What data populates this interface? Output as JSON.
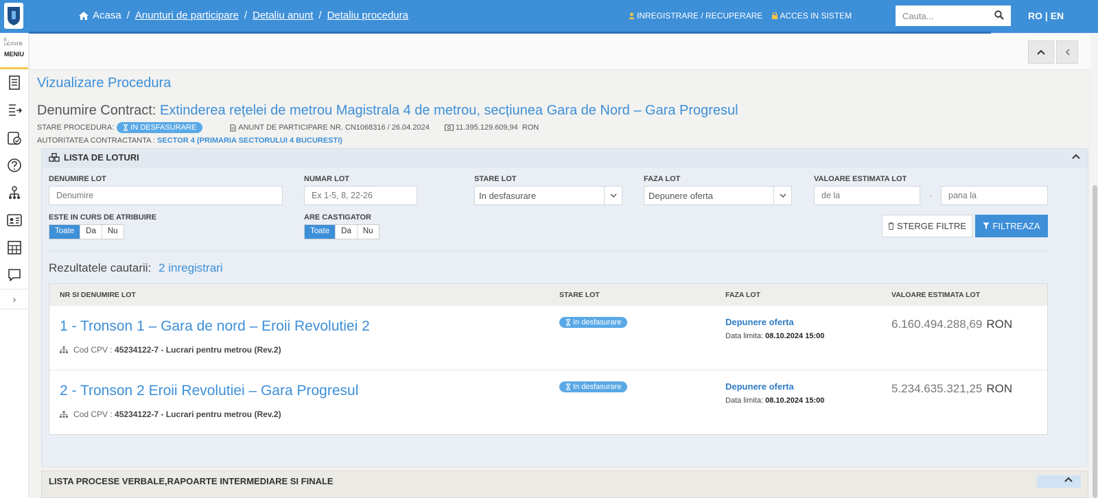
{
  "topbar": {
    "breadcrumb": {
      "home": "Acasa",
      "items": [
        "Anunturi de participare",
        "Detaliu anunt",
        "Detaliu procedura"
      ]
    },
    "register_label": "INREGISTRARE / RECUPERARE",
    "access_label": "ACCES IN SISTEM",
    "search": {
      "placeholder": "Cauta...",
      "value": ""
    },
    "lang": "RO | EN",
    "bar_color": "#3d8fd8"
  },
  "sidebar": {
    "brand": "E - LICITATIE",
    "menu_label": "MENIU",
    "icons": [
      "document-list-icon",
      "export-icon",
      "clipboard-check-icon",
      "help-icon",
      "user-tree-icon",
      "id-card-icon",
      "calendar-grid-icon",
      "chat-icon"
    ]
  },
  "header": {
    "page_title": "Vizualizare Procedura",
    "contract_label": "Denumire Contract:",
    "contract_name": "Extinderea rețelei de metrou Magistrala 4 de metrou, secțiunea Gara de Nord – Gara Progresul",
    "status_label": "STARE PROCEDURA:",
    "status_value": "IN DESFASURARE",
    "notice": "ANUNT DE PARTICIPARE NR. CN1068316 / 26.04.2024",
    "value": "11.395.129.609,94",
    "currency": "RON",
    "authority_label": "AUTORITATEA CONTRACTANTA :",
    "authority_value": "SECTOR 4 (PRIMARIA SECTORULUI 4 BUCURESTI)"
  },
  "lots_panel": {
    "title": "LISTA DE LOTURI",
    "filters": {
      "name_label": "DENUMIRE LOT",
      "name_placeholder": "Denumire",
      "number_label": "NUMAR LOT",
      "number_placeholder": "Ex 1-5, 8, 22-26",
      "state_label": "STARE LOT",
      "state_value": "In desfasurare",
      "phase_label": "FAZA LOT",
      "phase_value": "Depunere oferta",
      "estimate_label": "VALOARE ESTIMATA LOT",
      "from_placeholder": "de la",
      "to_placeholder": "pana la",
      "range_sep": "-",
      "awarding_label": "ESTE IN CURS DE ATRIBUIRE",
      "winner_label": "ARE CASTIGATOR",
      "options": [
        "Toate",
        "Da",
        "Nu"
      ],
      "selected": "Toate"
    },
    "clear_label": "STERGE FILTRE",
    "filter_label": "FILTREAZA",
    "results_label": "Rezultatele cautarii:",
    "results_count": "2 inregistrari",
    "columns": [
      "NR SI DENUMIRE LOT",
      "STARE LOT",
      "FAZA LOT",
      "VALOARE ESTIMATA LOT"
    ],
    "rows": [
      {
        "name": "1 - Tronson 1 – Gara de nord – Eroii Revolutiei 2",
        "cpv_label": "Cod CPV :",
        "cpv_value": "45234122-7 - Lucrari pentru metrou (Rev.2)",
        "state": "In desfasurare",
        "phase": "Depunere oferta",
        "deadline_label": "Data limita:",
        "deadline": "08.10.2024 15:00",
        "value": "6.160.494.288,69",
        "currency": "RON"
      },
      {
        "name": "2 - Tronson 2 Eroii Revolutiei – Gara Progresul",
        "cpv_label": "Cod CPV :",
        "cpv_value": "45234122-7 - Lucrari pentru metrou (Rev.2)",
        "state": "In desfasurare",
        "phase": "Depunere oferta",
        "deadline_label": "Data limita:",
        "deadline": "08.10.2024 15:00",
        "value": "5.234.635.321,25",
        "currency": "RON"
      }
    ]
  },
  "reports_panel": {
    "title": "LISTA PROCESE VERBALE,RAPOARTE INTERMEDIARE SI FINALE"
  }
}
